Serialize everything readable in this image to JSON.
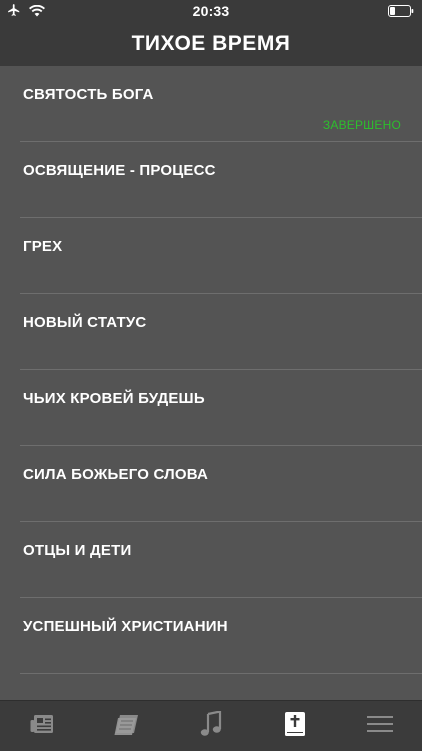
{
  "status_bar": {
    "time": "20:33"
  },
  "header": {
    "title": "ТИХОЕ ВРЕМЯ"
  },
  "lessons": [
    {
      "title": "СВЯТОСТЬ БОГА",
      "status": "ЗАВЕРШЕНО"
    },
    {
      "title": "ОСВЯЩЕНИЕ - ПРОЦЕСС",
      "status": ""
    },
    {
      "title": "ГРЕХ",
      "status": ""
    },
    {
      "title": "НОВЫЙ СТАТУС",
      "status": ""
    },
    {
      "title": "ЧЬИХ КРОВЕЙ БУДЕШЬ",
      "status": ""
    },
    {
      "title": "СИЛА БОЖЬЕГО СЛОВА",
      "status": ""
    },
    {
      "title": "ОТЦЫ И ДЕТИ",
      "status": ""
    },
    {
      "title": "УСПЕШНЫЙ ХРИСТИАНИН",
      "status": ""
    }
  ],
  "tab_bar": {
    "tabs": [
      {
        "icon": "newspaper-icon",
        "active": false
      },
      {
        "icon": "books-icon",
        "active": false
      },
      {
        "icon": "music-note-icon",
        "active": false
      },
      {
        "icon": "bible-icon",
        "active": true
      },
      {
        "icon": "menu-icon",
        "active": false
      }
    ]
  },
  "colors": {
    "background": "#545454",
    "bar": "#3a3a3a",
    "completed": "#2dbf2d",
    "active_tab": "#ffffff",
    "inactive_tab": "#8a8a8a"
  }
}
